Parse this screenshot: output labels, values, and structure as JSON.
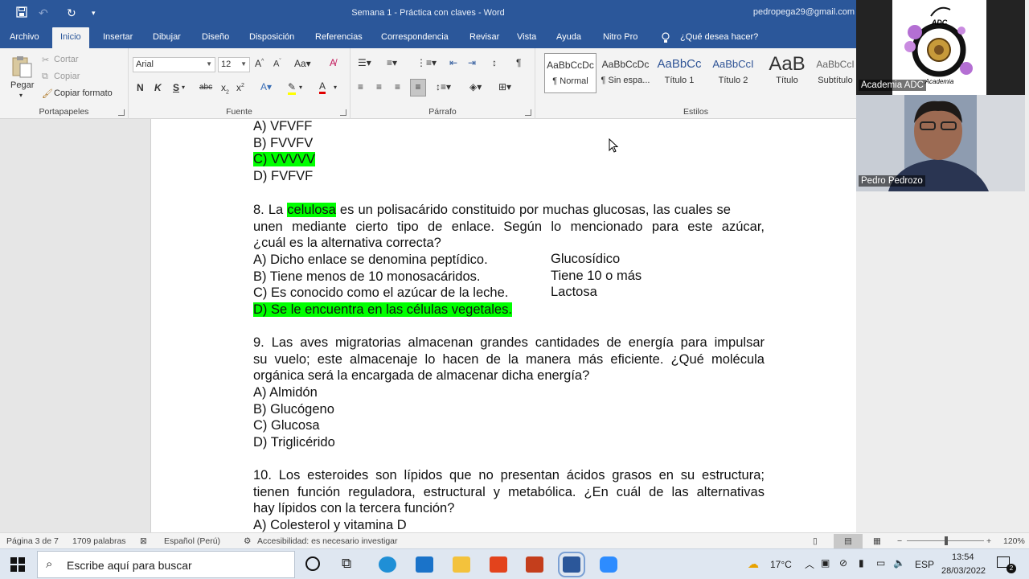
{
  "titlebar": {
    "title": "Semana 1 - Práctica con claves - Word",
    "account": "pedropega29@gmail.com"
  },
  "tabs": [
    "Archivo",
    "Inicio",
    "Insertar",
    "Dibujar",
    "Diseño",
    "Disposición",
    "Referencias",
    "Correspondencia",
    "Revisar",
    "Vista",
    "Ayuda",
    "Nitro Pro",
    "¿Qué desea hacer?"
  ],
  "ribbon": {
    "portapapeles": {
      "paste": "Pegar",
      "cut": "Cortar",
      "copy": "Copiar",
      "format": "Copiar formato",
      "label": "Portapapeles"
    },
    "fuente": {
      "font": "Arial",
      "size": "12",
      "label": "Fuente"
    },
    "parrafo": {
      "label": "Párrafo"
    },
    "estilos": {
      "label": "Estilos",
      "items": [
        {
          "preview": "AaBbCcDc",
          "name": "¶ Normal"
        },
        {
          "preview": "AaBbCcDc",
          "name": "¶ Sin espa..."
        },
        {
          "preview": "AaBbCc",
          "name": "Título 1"
        },
        {
          "preview": "AaBbCcI",
          "name": "Título 2"
        },
        {
          "preview": "AaB",
          "name": "Título"
        },
        {
          "preview": "AaBbCcI",
          "name": "Subtítulo"
        }
      ]
    }
  },
  "document": {
    "q7": {
      "a": "A) VFVFF",
      "b": "B) FVVFV",
      "c": "C) VVVVV",
      "d": "D) FVFVF"
    },
    "q8": {
      "l1_pre": "8. La ",
      "l1_hl": "celulosa",
      "l1_post": " es un polisacárido constituido por muchas glucosas, las cuales se",
      "l2": "unen mediante cierto tipo de enlace. Según lo mencionado para este azúcar,",
      "l3": "¿cuál es la alternativa correcta?",
      "a": "A) Dicho enlace se denomina peptídico.",
      "b": "B) Tiene menos de 10 monosacáridos.",
      "c": "C) Es conocido como el azúcar de la leche.",
      "d": "D) Se le encuentra en las células vegetales.",
      "note_a": "Glucosídico",
      "note_b": "Tiene 10 o más",
      "note_c": "Lactosa"
    },
    "q9": {
      "l1": "9. Las aves migratorias almacenan grandes cantidades de energía para impulsar",
      "l2": "su vuelo; este almacenaje lo hacen de la manera más eficiente. ¿Qué molécula",
      "l3": "orgánica será la encargada de almacenar dicha energía?",
      "a": "A) Almidón",
      "b": "B) Glucógeno",
      "c": "C) Glucosa",
      "d": "D) Triglicérido"
    },
    "q10": {
      "l1": "10. Los esteroides son lípidos que no presentan ácidos grasos en su estructura;",
      "l2": "tienen función reguladora, estructural y metabólica. ¿En cuál de las alternativas",
      "l3": "hay lípidos con la tercera función?",
      "a": "A) Colesterol y vitamina D"
    }
  },
  "status": {
    "page": "Página 3 de 7",
    "words": "1709 palabras",
    "lang": "Español (Perú)",
    "access": "Accesibilidad: es necesario investigar",
    "zoom": "120%"
  },
  "taskbar": {
    "search": "Escribe aquí para buscar",
    "temp": "17°C",
    "lang": "ESP",
    "time": "13:54",
    "date": "28/03/2022",
    "notif": "2"
  },
  "video": {
    "logo_text": "ADC",
    "logo_sub": "Academia",
    "tile1": "Academia ADC",
    "tile2": "Pedro Pedrozo"
  },
  "colors": {
    "word_blue": "#2b579a",
    "highlight": "#00ff00"
  }
}
